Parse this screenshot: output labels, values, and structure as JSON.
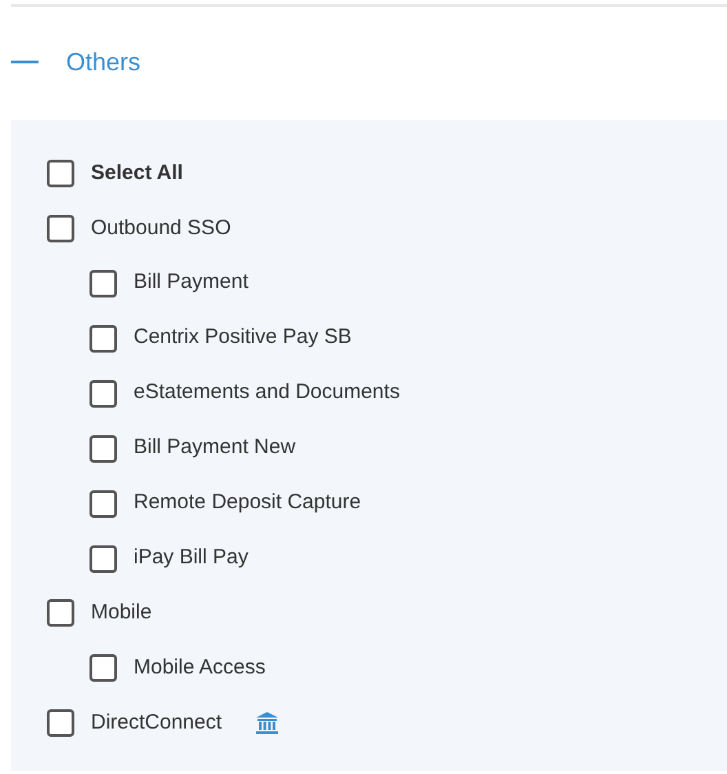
{
  "section": {
    "title": "Others",
    "expanded": true
  },
  "select_all": {
    "label": "Select All",
    "checked": false
  },
  "items": [
    {
      "label": "Outbound SSO",
      "checked": false,
      "kind": "plain",
      "children": [
        {
          "label": "Bill Payment",
          "checked": false
        },
        {
          "label": "Centrix Positive Pay SB",
          "checked": false
        },
        {
          "label": "eStatements and Documents",
          "checked": false
        },
        {
          "label": "Bill Payment New",
          "checked": false
        },
        {
          "label": "Remote Deposit Capture",
          "checked": false
        },
        {
          "label": "iPay Bill Pay",
          "checked": false
        }
      ]
    },
    {
      "label": "Mobile",
      "checked": false,
      "kind": "plain",
      "children": [
        {
          "label": "Mobile Access",
          "checked": false
        }
      ]
    },
    {
      "label": "DirectConnect",
      "checked": false,
      "kind": "institution"
    }
  ]
}
